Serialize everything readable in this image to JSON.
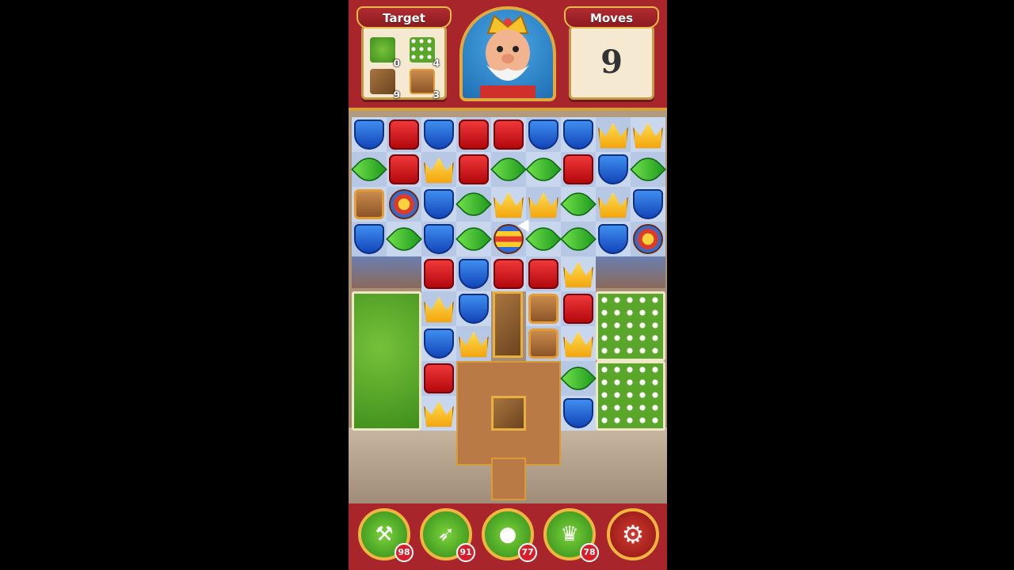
{
  "header": {
    "target_title": "Target",
    "moves_title": "Moves",
    "moves_value": "9",
    "targets": [
      {
        "icon": "hedge-icon",
        "count": "0",
        "color": "#4fae26"
      },
      {
        "icon": "flower-bed-icon",
        "count": "4",
        "color": "#5aa62a"
      },
      {
        "icon": "crate-icon",
        "count": "9",
        "color": "#8c5428"
      },
      {
        "icon": "box-icon",
        "count": "3",
        "color": "#c98b4d"
      }
    ]
  },
  "board_rows": [
    [
      "shield",
      "cube",
      "shield",
      "cube",
      "cube",
      "shield",
      "shield",
      "crown",
      "crown"
    ],
    [
      "leaf",
      "cube",
      "crown",
      "cube",
      "leaf",
      "leaf",
      "cube",
      "shield",
      "leaf"
    ],
    [
      "box",
      "jester",
      "shield",
      "leaf",
      "crown",
      "crown",
      "leaf",
      "crown",
      "shield"
    ],
    [
      "shield",
      "leaf",
      "shield",
      "leaf",
      "rocket",
      "leaf",
      "leaf",
      "shield",
      "jester"
    ],
    [
      "",
      "",
      "cube",
      "shield",
      "cube",
      "cube",
      "crown",
      "",
      ""
    ],
    [
      "",
      "",
      "crown",
      "shield",
      "",
      "box",
      "cube",
      "",
      ""
    ],
    [
      "",
      "",
      "shield",
      "crown",
      "",
      "box",
      "crown",
      "",
      ""
    ],
    [
      "",
      "",
      "cube",
      "",
      "",
      "",
      "leaf",
      "",
      ""
    ],
    [
      "",
      "",
      "crown",
      "",
      "",
      "",
      "shield",
      "",
      ""
    ]
  ],
  "boosters": [
    {
      "icon": "hammer-icon",
      "count": "98"
    },
    {
      "icon": "arrow-icon",
      "count": "91"
    },
    {
      "icon": "cannon-icon",
      "count": "77"
    },
    {
      "icon": "jester-hat-icon",
      "count": "78"
    }
  ],
  "settings_icon": "gear-icon"
}
